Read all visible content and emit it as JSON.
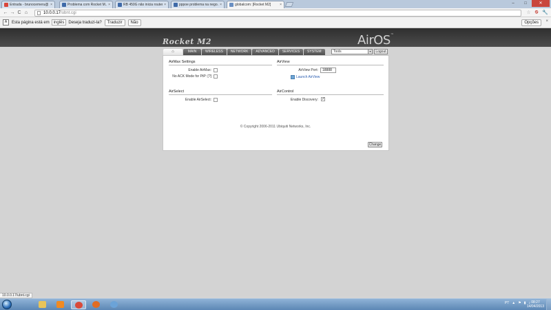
{
  "browser": {
    "tabs": [
      {
        "label": "Entrada - brunocemeru@...",
        "favicon_color": "#d9463b",
        "active": false
      },
      {
        "label": "Problema com Rocket M...",
        "favicon_color": "#3f6aa8",
        "active": false
      },
      {
        "label": "RB 450G não inicia routeros",
        "favicon_color": "#3f6aa8",
        "active": false
      },
      {
        "label": "pppoe problema na nego...",
        "favicon_color": "#3f6aa8",
        "active": false
      },
      {
        "label": "globalcom: [Rocket M2]",
        "favicon_color": "#6a8fc2",
        "active": true
      }
    ],
    "tab_close_glyph": "×",
    "window_buttons": {
      "minimize": "–",
      "maximize": "□",
      "close": "✕"
    },
    "nav": {
      "back": "←",
      "forward": "→",
      "reload": "C",
      "home": "⌂"
    },
    "address": {
      "domain": "10.0.0.17",
      "path": "/ubnt.cgi"
    },
    "icons": {
      "star": "☆",
      "block": "⦸",
      "wrench": "🔧"
    }
  },
  "translate_bar": {
    "prefix": "Esta página está em",
    "language": "inglês",
    "question": "Deseja traduzi-la?",
    "translate_button": "Traduzir",
    "no_button": "Não",
    "options_button": "Opções",
    "close": "×"
  },
  "airos": {
    "brand_left": "Rocket M2",
    "brand_right": "AirOS",
    "brand_tm": "™",
    "nav_home_glyph": "⌂",
    "nav_tabs": [
      "MAIN",
      "WIRELESS",
      "NETWORK",
      "ADVANCED",
      "SERVICES",
      "SYSTEM"
    ],
    "tools_select": "Tools",
    "tools_arrow": "▾",
    "logout_label": "Logout",
    "airmax": {
      "title": "AirMax Settings",
      "enable_label": "Enable AirMax:",
      "enable_checked": false,
      "noack_label": "No ACK Mode for PtP: [?]",
      "noack_checked": false
    },
    "airview": {
      "title": "AirView",
      "port_label": "AirView Port:",
      "port_value": "18888",
      "launch_label": "Launch AirView"
    },
    "airselect": {
      "title": "AirSelect",
      "enable_label": "Enable AirSelect:",
      "enable_checked": false
    },
    "aircontrol": {
      "title": "AirControl",
      "discovery_label": "Enable Discovery:",
      "discovery_checked": true,
      "discovery_mark": "✓"
    },
    "change_button": "Change",
    "copyright": "© Copyright 2006-2011 Ubiquiti Networks, Inc."
  },
  "status_url": "10.0.0.17/ubnt.cgi",
  "taskbar": {
    "items": [
      {
        "name": "explorer",
        "color": "#e8c45a",
        "active": false
      },
      {
        "name": "media-player",
        "color": "#f08a23",
        "active": false
      },
      {
        "name": "chrome",
        "color": "#d94a3a",
        "active": true
      },
      {
        "name": "firefox",
        "color": "#e06c22",
        "active": false
      },
      {
        "name": "app",
        "color": "#6ba3d8",
        "active": false
      }
    ],
    "language": "PT",
    "tray_icons": [
      "▲",
      "⚑",
      "▮",
      "♪"
    ],
    "time": "08:27",
    "date": "14/04/2013"
  }
}
